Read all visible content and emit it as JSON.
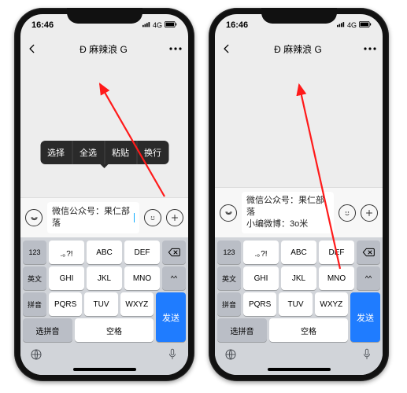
{
  "status": {
    "time": "16:46",
    "network": "4G",
    "signal_icon": "signal-icon",
    "battery_icon": "battery-icon"
  },
  "nav": {
    "back_icon": "chevron-left-icon",
    "title": "Ð 麻辣浪 G",
    "more_icon": "more-icon"
  },
  "context_menu": {
    "items": [
      "选择",
      "全选",
      "粘贴",
      "换行"
    ]
  },
  "input": {
    "voice_icon": "voice-icon",
    "emoji_icon": "smile-icon",
    "plus_icon": "plus-icon",
    "left_value": "微信公众号：果仁部落",
    "right_value": "微信公众号：果仁部落\n小编微博：3o米"
  },
  "keyboard": {
    "row1_side_l": "123",
    "row1": [
      ".｡?!",
      "ABC",
      "DEF"
    ],
    "row1_side_r": "⌫",
    "row2_side_l": "英文",
    "row2": [
      "GHI",
      "JKL",
      "MNO"
    ],
    "row2_side_r": "^^",
    "row3_side_l": "拼音",
    "row3": [
      "PQRS",
      "TUV",
      "WXYZ"
    ],
    "row4": [
      "选拼音",
      "空格"
    ],
    "send": "发送",
    "globe_icon": "globe-icon",
    "mic_icon": "mic-icon"
  }
}
